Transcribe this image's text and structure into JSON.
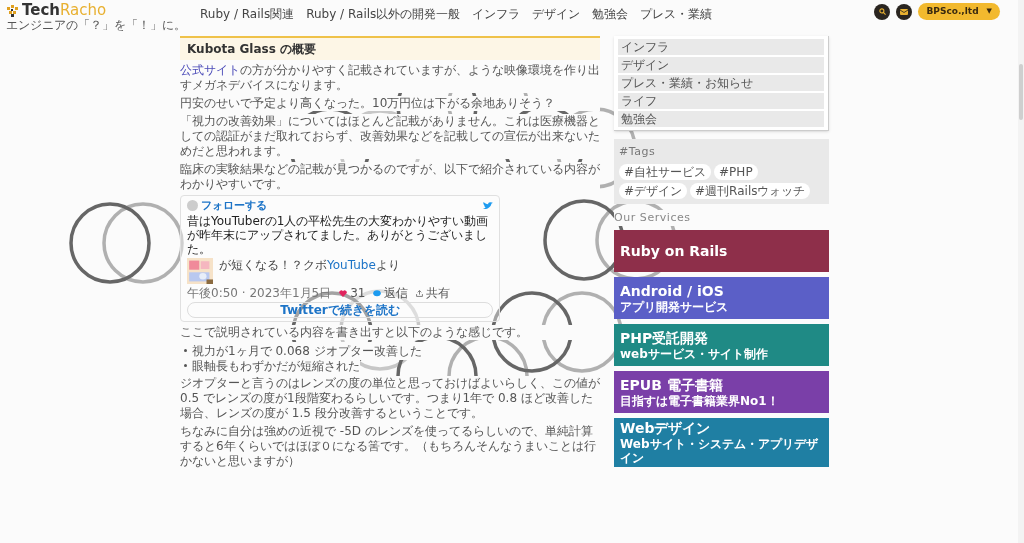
{
  "header": {
    "logo_a": "Tech",
    "logo_b": "Racho",
    "tagline": "エンジニアの「？」を「！」に。",
    "nav": [
      "Ruby / Rails関連",
      "Ruby / Rails以外の開発一般",
      "インフラ",
      "デザイン",
      "勉強会",
      "プレス・業績"
    ],
    "company_button": "BPSco.,ltd",
    "company_caret": "▼"
  },
  "article": {
    "heading": "Kubota Glass の概要",
    "paragraphs_top": [
      {
        "link": "公式サイト",
        "text": "の方が分かりやすく記載されていますが、ような映像環境を作り出すメガネデバイスになります。"
      },
      {
        "text": "円安のせいで予定より高くなった。10万円位は下がる余地ありそう？"
      },
      {
        "text": "「視力の改善効果」についてはほとんど記載がありません。これは医療機器としての認証がまだ取れておらず、改善効果などを記載しての宣伝が出来ないためだと思われます。"
      },
      {
        "text": "臨床の実験結果などの記載が見つかるのですが、以下で紹介されている内容がわかりやすいです。"
      }
    ],
    "tweet": {
      "follow": "フォローする",
      "text": "昔はYouTuberの1人の平松先生の大変わかりやすい動画が昨年末にアップされてました。ありがとうございました。",
      "video_text": "が短くなる！？クボ",
      "video_link": "YouTube",
      "video_suffix": "より",
      "time": "午後0:50 · 2023年1月5日",
      "likes": "31",
      "reply": "返信",
      "share": "共有",
      "read_more": "Twitterで続きを読む"
    },
    "summary": "ここで説明されている内容を書き出すと以下のような感じです。",
    "bullets": [
      "視力が1ヶ月で 0.068 ジオプター改善した",
      "眼軸長もわずかだが短縮された"
    ],
    "paragraphs_bottom": [
      "ジオプターと言うのはレンズの度の単位と思っておけばよいらしく、この値が 0.5 でレンズの度が1段階変わるらしいです。つまり1年で 0.8 ほど改善した場合、レンズの度が 1.5 段分改善するということです。",
      "ちなみに自分は強めの近視で -5D のレンズを使ってるらしいので、単純計算すると6年くらいではほぼ０になる筈です。（もちろんそんなうまいことは行かないと思いますが）"
    ]
  },
  "sidebar": {
    "categories": [
      "インフラ",
      "デザイン",
      "プレス・業績・お知らせ",
      "ライフ",
      "勉強会"
    ],
    "tags_title": "#Tags",
    "tags": [
      "#自社サービス",
      "#PHP",
      "#デザイン",
      "#週刊Railsウォッチ"
    ],
    "services_title": "Our Services",
    "services": [
      {
        "title": "Ruby on Rails",
        "color": "#8e2f4a"
      },
      {
        "title": "Android / iOS",
        "subtitle": "アプリ開発サービス",
        "color": "#5b5fc7"
      },
      {
        "title": "PHP受託開発",
        "subtitle": "webサービス・サイト制作",
        "color": "#1f8a85"
      },
      {
        "title": "EPUB 電子書籍",
        "subtitle": "目指すは電子書籍業界No1！",
        "color": "#7a3fa8"
      },
      {
        "title": "Webデザイン",
        "subtitle": "Webサイト・システム・アプリデザイン",
        "color": "#1f7fa3"
      }
    ]
  }
}
